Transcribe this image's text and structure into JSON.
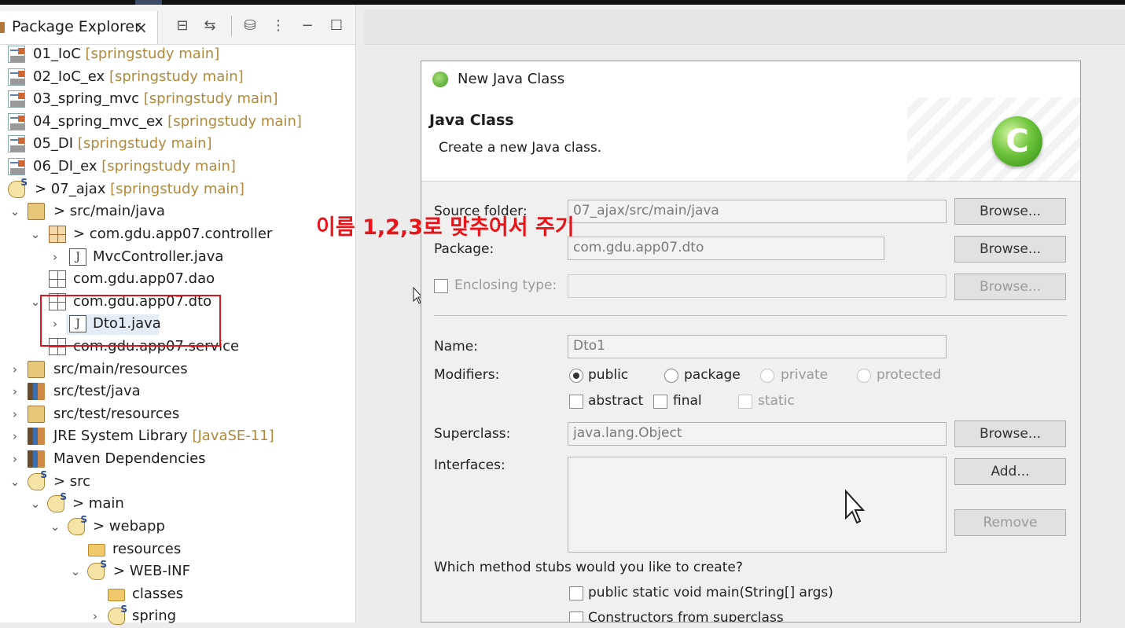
{
  "package_explorer": {
    "tab_title": "Package Explorer",
    "close": "×",
    "toolbar": {
      "collapse": "⊟",
      "link": "⇆",
      "filter": "⛁",
      "menu": "⋮",
      "minimize": "−",
      "maximize": "☐"
    },
    "rows": [
      {
        "label": "01_IoC",
        "sub": "[springstudy main]"
      },
      {
        "label": "02_IoC_ex",
        "sub": "[springstudy main]"
      },
      {
        "label": "03_spring_mvc",
        "sub": "[springstudy main]"
      },
      {
        "label": "04_spring_mvc_ex",
        "sub": "[springstudy main]"
      },
      {
        "label": "05_DI",
        "sub": "[springstudy main]"
      },
      {
        "label": "06_DI_ex",
        "sub": "[springstudy main]"
      },
      {
        "label": "> 07_ajax",
        "sub": "[springstudy main]"
      },
      {
        "label": "> src/main/java"
      },
      {
        "label": "> com.gdu.app07.controller"
      },
      {
        "label": "MvcController.java"
      },
      {
        "label": "com.gdu.app07.dao"
      },
      {
        "label": "com.gdu.app07.dto"
      },
      {
        "label": "Dto1.java"
      },
      {
        "label": "com.gdu.app07.service"
      },
      {
        "label": "src/main/resources"
      },
      {
        "label": "src/test/java"
      },
      {
        "label": "src/test/resources"
      },
      {
        "label": "JRE System Library",
        "sub": "[JavaSE-11]"
      },
      {
        "label": "Maven Dependencies"
      },
      {
        "label": "> src"
      },
      {
        "label": "> main"
      },
      {
        "label": "> webapp"
      },
      {
        "label": "resources"
      },
      {
        "label": "> WEB-INF"
      },
      {
        "label": "classes"
      },
      {
        "label": "spring"
      }
    ]
  },
  "annotation": "이름 1,2,3로 맞추어서 주기",
  "dialog": {
    "window_title": "New Java Class",
    "header_title": "Java Class",
    "header_subtitle": "Create a new Java class.",
    "logo": "C",
    "source_folder_label": "Source folder:",
    "source_folder_value": "07_ajax/src/main/java",
    "package_label": "Package:",
    "package_value": "com.gdu.app07.dto",
    "enclosing_label": "Enclosing type:",
    "enclosing_value": "",
    "browse": "Browse...",
    "name_label": "Name:",
    "name_value": "Dto1",
    "modifiers_label": "Modifiers:",
    "mod_public": "public",
    "mod_package": "package",
    "mod_private": "private",
    "mod_protected": "protected",
    "mod_abstract": "abstract",
    "mod_final": "final",
    "mod_static": "static",
    "superclass_label": "Superclass:",
    "superclass_value": "java.lang.Object",
    "interfaces_label": "Interfaces:",
    "add": "Add...",
    "remove": "Remove",
    "stubs_question": "Which method stubs would you like to create?",
    "stub_main": "public static void main(String[] args)",
    "stub_constructors": "Constructors from superclass"
  }
}
